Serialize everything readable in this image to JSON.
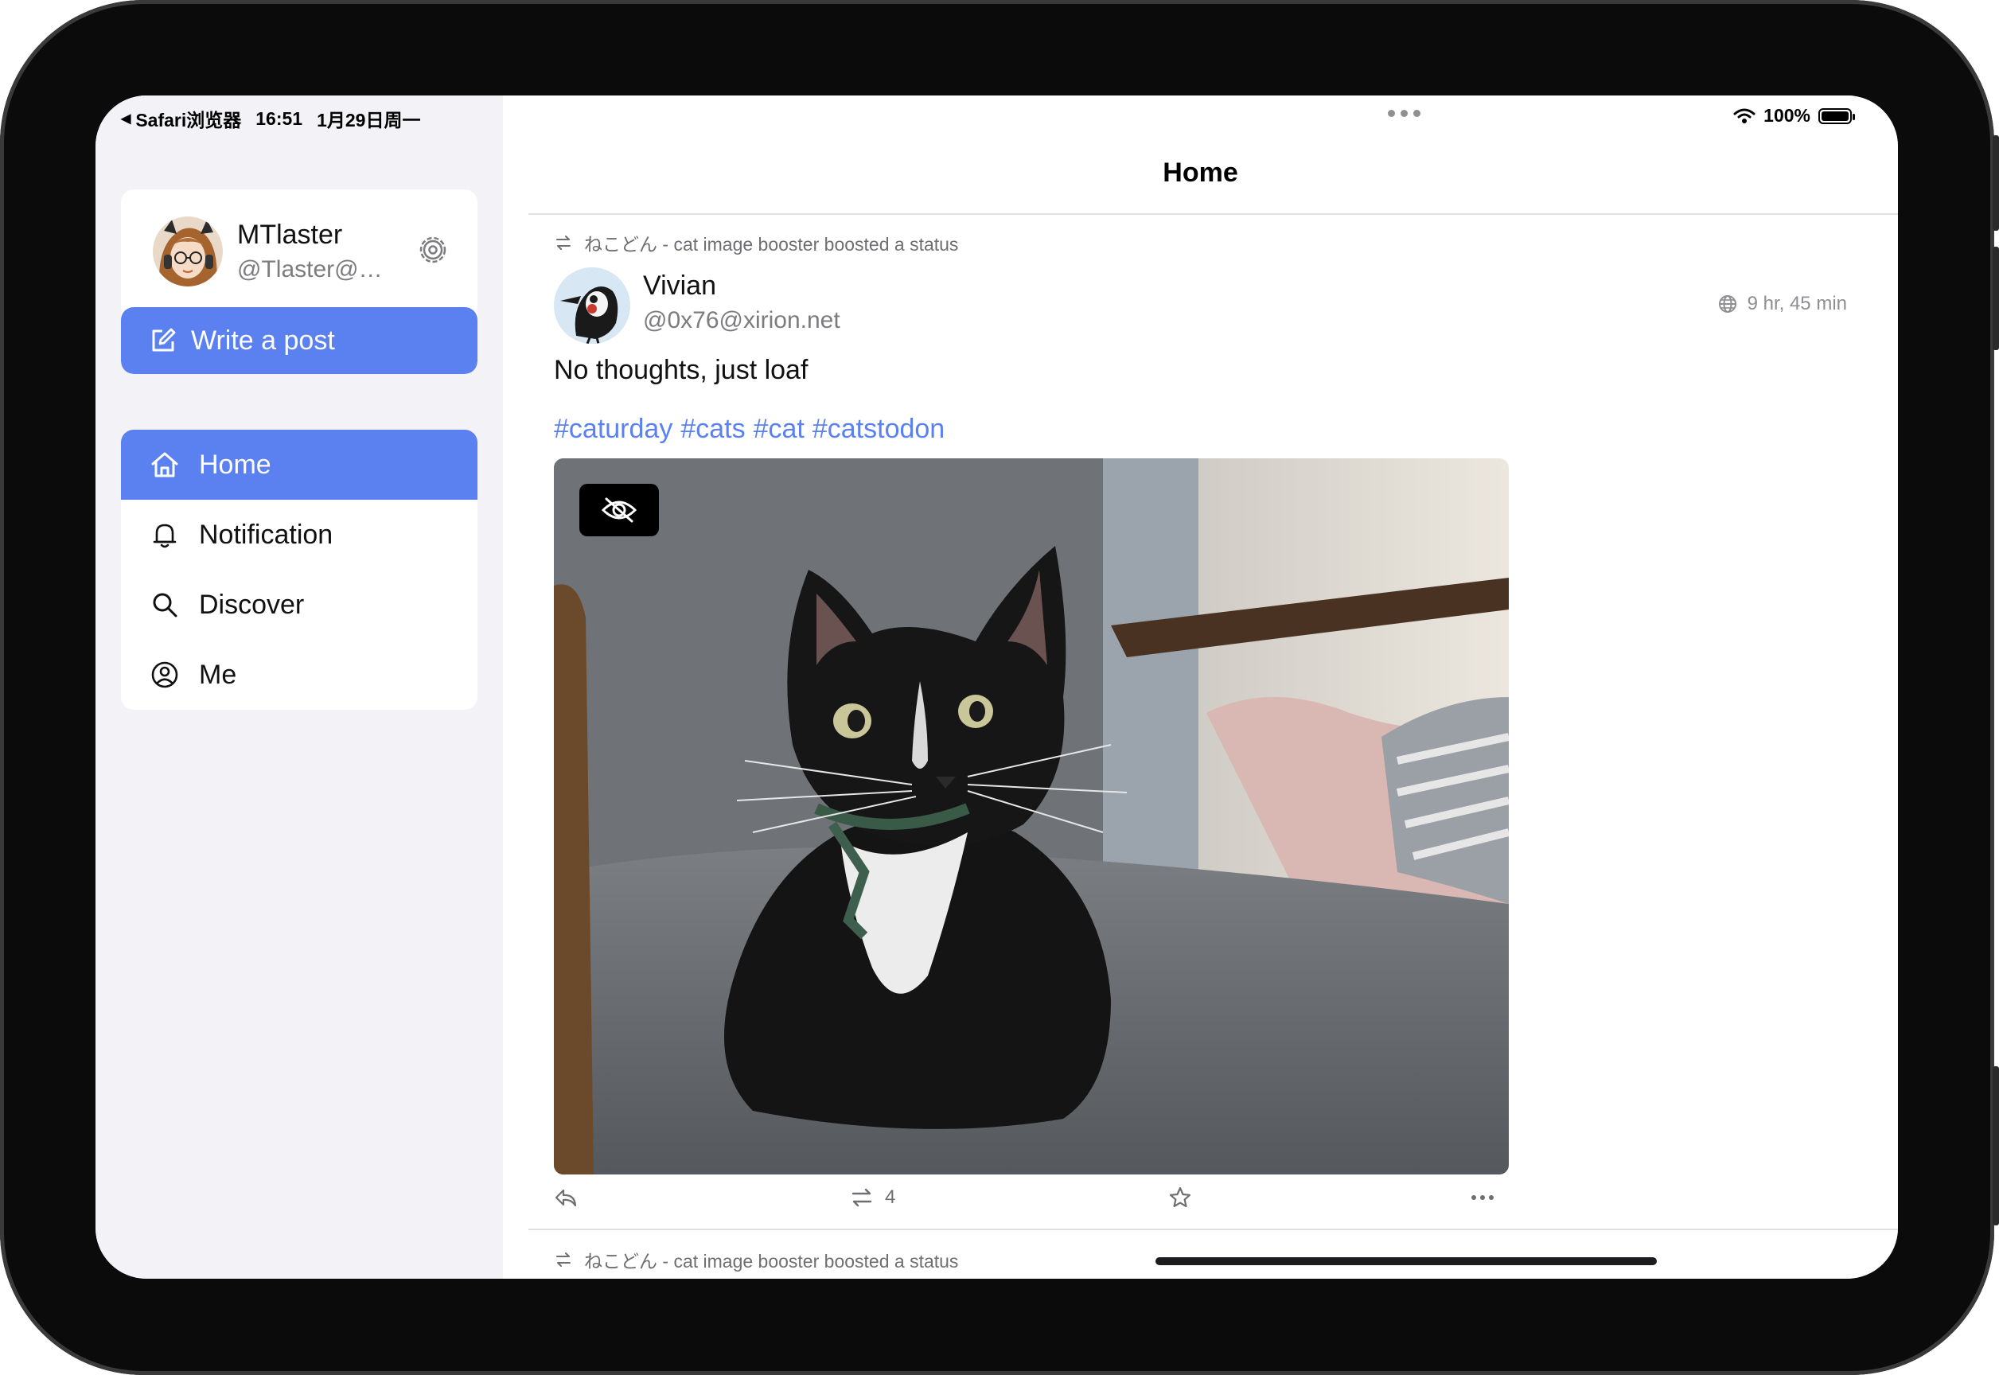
{
  "status_bar": {
    "back_app": "Safari浏览器",
    "time": "16:51",
    "date": "1月29日周一",
    "battery": "100%"
  },
  "account": {
    "name": "MTlaster",
    "handle": "@Tlaster@m..."
  },
  "write_button": "Write a post",
  "nav": {
    "items": [
      {
        "label": "Home",
        "icon": "home-icon",
        "active": true
      },
      {
        "label": "Notification",
        "icon": "bell-icon",
        "active": false
      },
      {
        "label": "Discover",
        "icon": "search-icon",
        "active": false
      },
      {
        "label": "Me",
        "icon": "user-circle-icon",
        "active": false
      }
    ]
  },
  "main": {
    "title": "Home",
    "boost_text": "ねこどん - cat image booster boosted a status",
    "post": {
      "author_name": "Vivian",
      "author_handle": "@0x76@xirion.net",
      "time": "9 hr, 45 min",
      "text": "No thoughts, just loaf",
      "tags": [
        "#caturday",
        "#cats",
        "#cat",
        "#catstodon"
      ],
      "reblog_count": "4"
    },
    "next_boost_text": "ねこどん - cat image booster boosted a status"
  },
  "colors": {
    "accent": "#5b81f0",
    "sidebar_bg": "#f2f2f7",
    "secondary_text": "#7c7c80"
  }
}
